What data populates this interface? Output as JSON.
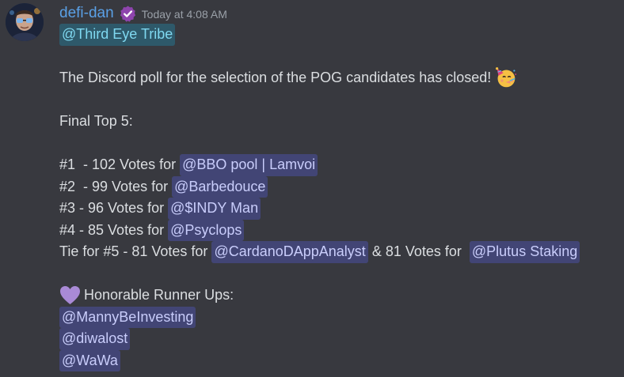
{
  "author": {
    "username": "defi-dan",
    "timestamp": "Today at 4:08 AM"
  },
  "message": {
    "role_mention": "@Third Eye Tribe",
    "announcement": "The Discord poll for the selection of the POG candidates has closed!",
    "announcement_emoji": "partying-face-emoji",
    "final_top_heading": "Final Top 5:",
    "results": [
      {
        "prefix": "#1  - 102 Votes for ",
        "mention": "@BBO pool | Lamvoi"
      },
      {
        "prefix": "#2  - 99 Votes for ",
        "mention": "@Barbedouce"
      },
      {
        "prefix": "#3 - 96 Votes for ",
        "mention": "@$INDY Man"
      },
      {
        "prefix": "#4 - 85 Votes for ",
        "mention": "@Psyclops"
      }
    ],
    "tie": {
      "prefix": "Tie for #5 - 81 Votes for ",
      "mention_a": "@CardanoDAppAnalyst",
      "middle": " & 81 Votes for ",
      "mention_b": "@Plutus Staking"
    },
    "runner_ups_heading": "Honorable Runner Ups:",
    "runner_ups_icon": "purple-heart-emoji",
    "runner_ups": [
      "@MannyBeInvesting",
      "@diwalost",
      "@WaWa"
    ]
  },
  "colors": {
    "background": "#38393f",
    "username": "#5aa0e6",
    "text": "#dbdee1",
    "mention_bg": "rgba(88,101,242,0.30)",
    "role_mention_text": "#7fd8f0",
    "verified_badge": "#8e44ad"
  }
}
